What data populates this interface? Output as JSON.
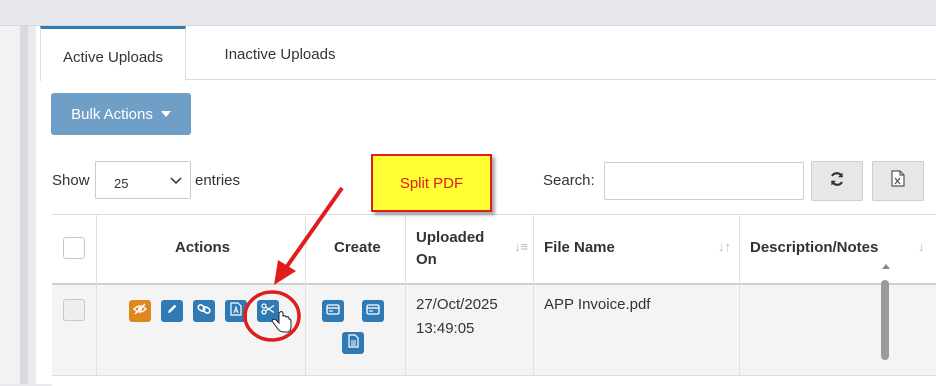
{
  "tabs": [
    {
      "label": "Active Uploads"
    },
    {
      "label": "Inactive Uploads"
    }
  ],
  "bulk_actions": {
    "label": "Bulk Actions"
  },
  "length_menu": {
    "show_label": "Show",
    "selected": "25",
    "entries_label": "entries"
  },
  "search": {
    "label": "Search:",
    "value": ""
  },
  "table": {
    "headers": [
      {
        "label": ""
      },
      {
        "label": "Actions"
      },
      {
        "label": "Create"
      },
      {
        "label": "Uploaded On"
      },
      {
        "label": "File Name"
      },
      {
        "label": "Description/Notes"
      }
    ],
    "uploaded_on_lines": [
      "Uploaded",
      "On"
    ],
    "rows": [
      {
        "uploaded_date": "27/Oct/2025",
        "uploaded_time": "13:49:05",
        "file_name": "APP Invoice.pdf",
        "description": ""
      }
    ]
  },
  "annotation": {
    "callout_text": "Split PDF",
    "color": "#e01c1c",
    "callout_bg": "#ffff33"
  },
  "colors": {
    "primary": "#2f7ab4",
    "hide_button": "#e0861f",
    "bulk_button": "#6f9fc7"
  },
  "icons": {
    "row_actions": [
      "eye-slash-icon",
      "pencil-icon",
      "link-icon",
      "pdf-file-icon",
      "scissors-icon"
    ],
    "create_actions": [
      "card-icon",
      "card-icon",
      "document-icon"
    ],
    "toolbar": [
      "refresh-icon",
      "excel-file-icon"
    ]
  }
}
